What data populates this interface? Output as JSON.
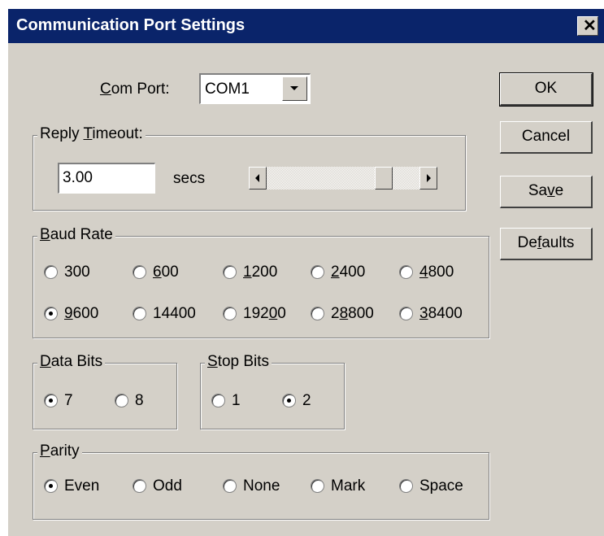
{
  "window": {
    "title": "Communication Port Settings",
    "close_glyph": "✕"
  },
  "com_port": {
    "label_u": "C",
    "label_rest": "om Port:",
    "value": "COM1"
  },
  "buttons": {
    "ok": "OK",
    "cancel": "Cancel",
    "save": {
      "a": "Sa",
      "u": "v",
      "b": "e"
    },
    "defaults": {
      "a": "De",
      "u": "f",
      "b": "aults"
    }
  },
  "reply_timeout": {
    "label_a": "Reply ",
    "label_u": "T",
    "label_b": "imeout:",
    "value": "3.00",
    "unit": "secs",
    "slider_level": 0.8
  },
  "baud_rate": {
    "legend_u": "B",
    "legend_rest": "aud Rate",
    "options": [
      {
        "a": "300",
        "u": "",
        "b": "",
        "checked": false
      },
      {
        "a": "",
        "u": "6",
        "b": "00",
        "checked": false
      },
      {
        "a": "",
        "u": "1",
        "b": "200",
        "checked": false
      },
      {
        "a": "",
        "u": "2",
        "b": "400",
        "checked": false
      },
      {
        "a": "",
        "u": "4",
        "b": "800",
        "checked": false
      },
      {
        "a": "",
        "u": "9",
        "b": "600",
        "checked": true
      },
      {
        "a": "14400",
        "u": "",
        "b": "",
        "checked": false
      },
      {
        "a": "192",
        "u": "0",
        "b": "0",
        "checked": false
      },
      {
        "a": "2",
        "u": "8",
        "b": "800",
        "checked": false
      },
      {
        "a": "",
        "u": "3",
        "b": "8400",
        "checked": false
      }
    ]
  },
  "data_bits": {
    "legend_u": "D",
    "legend_rest": "ata Bits",
    "options": [
      {
        "label": "7",
        "checked": true
      },
      {
        "label": "8",
        "checked": false
      }
    ]
  },
  "stop_bits": {
    "legend_u": "S",
    "legend_rest": "top Bits",
    "options": [
      {
        "label": "1",
        "checked": false
      },
      {
        "label": "2",
        "checked": true
      }
    ]
  },
  "parity": {
    "legend_u": "P",
    "legend_rest": "arity",
    "options": [
      {
        "label": "Even",
        "checked": true
      },
      {
        "label": "Odd",
        "checked": false
      },
      {
        "label": "None",
        "checked": false
      },
      {
        "label": "Mark",
        "checked": false
      },
      {
        "label": "Space",
        "checked": false
      }
    ]
  },
  "colors": {
    "titlebar": "#0a246a",
    "face": "#d4d0c8"
  }
}
